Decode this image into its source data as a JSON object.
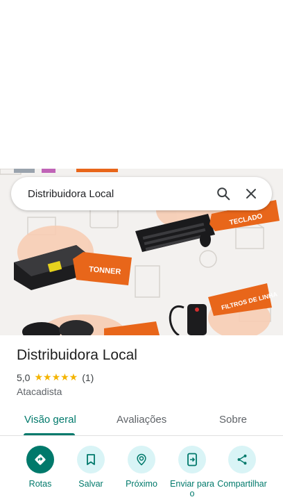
{
  "search": {
    "query": "Distribuidora Local"
  },
  "photo": {
    "labels": [
      "TONNER",
      "TECLADO",
      "FILTROS DE LINHA"
    ],
    "accent": "#e8661a"
  },
  "place": {
    "name": "Distribuidora Local",
    "rating": "5,0",
    "stars": "★★★★★",
    "reviews": "(1)",
    "category": "Atacadista"
  },
  "tabs": [
    {
      "label": "Visão geral",
      "active": true
    },
    {
      "label": "Avaliações",
      "active": false
    },
    {
      "label": "Sobre",
      "active": false
    }
  ],
  "actions": [
    {
      "label": "Rotas",
      "icon": "directions-icon"
    },
    {
      "label": "Salvar",
      "icon": "bookmark-icon"
    },
    {
      "label": "Próximo",
      "icon": "nearby-icon"
    },
    {
      "label": "Enviar para o",
      "icon": "send-to-phone-icon"
    },
    {
      "label": "Compartilhar",
      "icon": "share-icon"
    }
  ],
  "colors": {
    "accent": "#00796b",
    "action_bg": "#d9f4f6",
    "star": "#f4b400"
  }
}
